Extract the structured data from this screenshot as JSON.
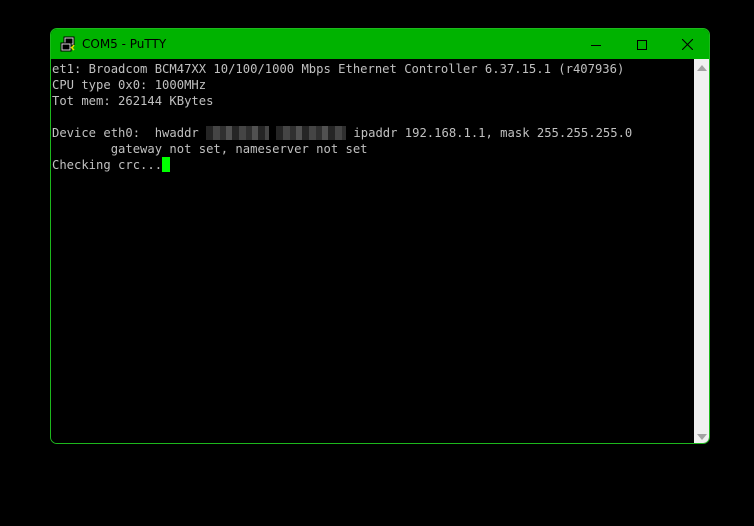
{
  "window": {
    "title": "COM5 - PuTTY",
    "accent_color": "#00b300",
    "icons": {
      "app": "putty-terminal-icon",
      "minimize": "minimize-icon",
      "maximize": "maximize-icon",
      "close": "close-icon"
    }
  },
  "terminal": {
    "text_color": "#c0c0c0",
    "cursor_color": "#00ff00",
    "lines": {
      "0": "et1: Broadcom BCM47XX 10/100/1000 Mbps Ethernet Controller 6.37.15.1 (r407936)",
      "1": "CPU type 0x0: 1000MHz",
      "2": "Tot mem: 262144 KBytes",
      "3": "",
      "4": {
        "prefix": "Device eth0:  hwaddr ",
        "suffix": " ipaddr 192.168.1.1, mask 255.255.255.0"
      },
      "5": "        gateway not set, nameserver not set",
      "6": "Checking crc..."
    }
  }
}
